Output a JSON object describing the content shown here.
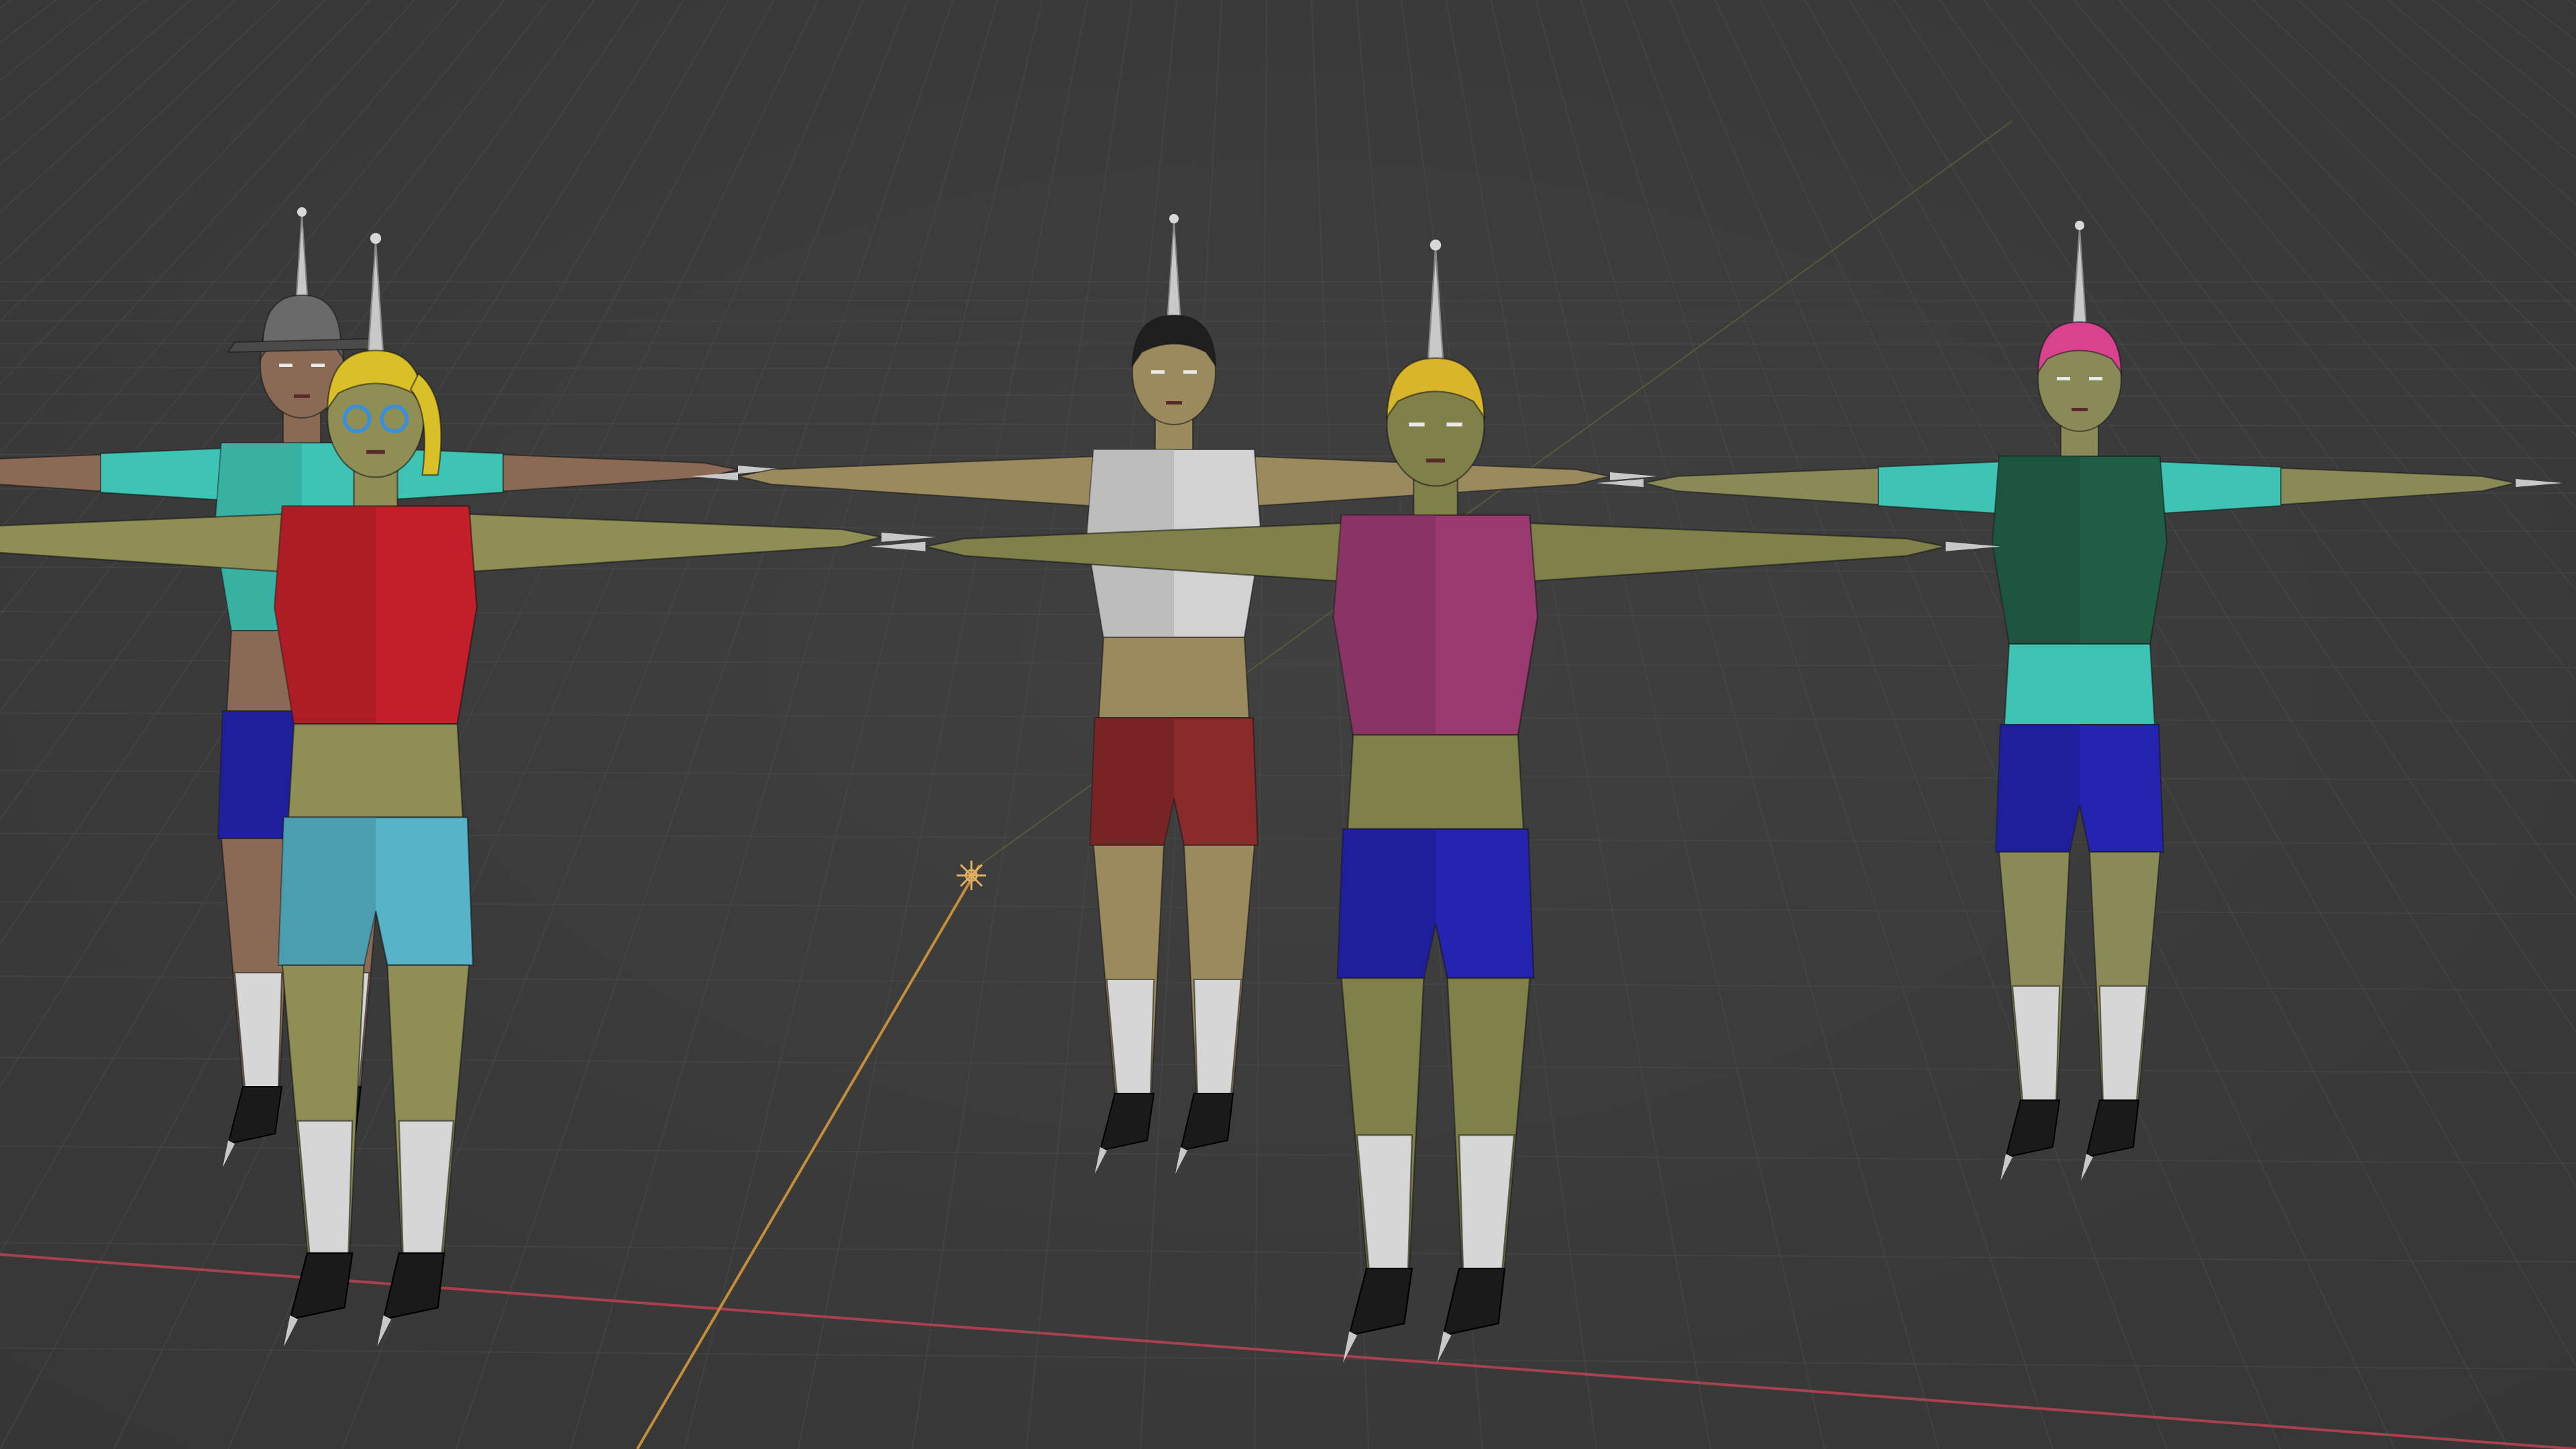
{
  "viewport": {
    "kind": "3D viewport",
    "shading": "solid",
    "background": "#3d3d3d",
    "grid_color": "#4a4a4a",
    "x_axis_color": "#a8414d",
    "y_axis_color": "#c58d3c"
  },
  "figures": [
    {
      "name": "figure-back-cap",
      "skin": "#8a6a55",
      "top": "#3ec3b4",
      "bottom": "#2424b0",
      "hair": "#555555",
      "hat": "#6a6a6a",
      "footwear": "#1a1a1a"
    },
    {
      "name": "figure-front-left",
      "skin": "#8f8f55",
      "top": "#c21f2a",
      "bottom": "#56b3c8",
      "hair": "#d9bf28",
      "glasses": "#3a8fd8",
      "footwear": "#1a1a1a"
    },
    {
      "name": "figure-center-back",
      "skin": "#9a8a5e",
      "top": "#d2d2d2",
      "bottom": "#8a2a2a",
      "hair": "#1f1f1f",
      "footwear": "#1a1a1a"
    },
    {
      "name": "figure-center-front",
      "skin": "#80804a",
      "top": "#9a3a70",
      "bottom": "#2424b0",
      "hair": "#d8b52a",
      "footwear": "#1a1a1a"
    },
    {
      "name": "figure-right",
      "skin": "#8a8a58",
      "top": "#1f5e45",
      "sleeves": "#3ec3b4",
      "bottom": "#2424b0",
      "hair": "#d8428f",
      "footwear": "#1a1a1a"
    }
  ]
}
